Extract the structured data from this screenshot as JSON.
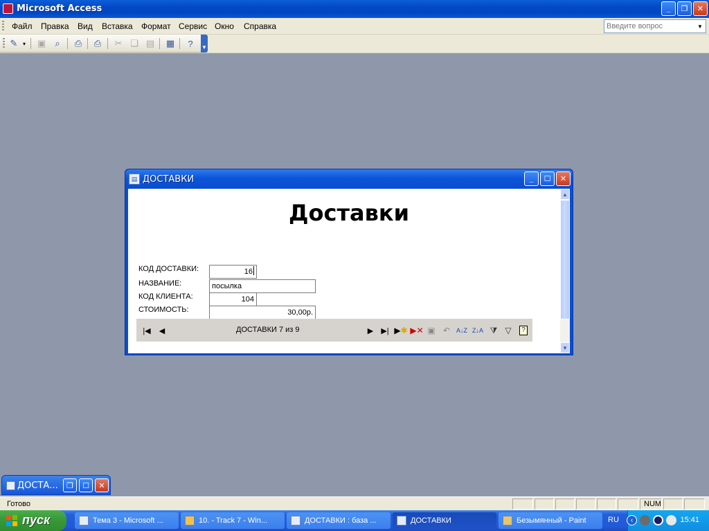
{
  "app": {
    "title": "Microsoft Access"
  },
  "menu": {
    "items": [
      "Файл",
      "Правка",
      "Вид",
      "Вставка",
      "Формат",
      "Сервис",
      "Окно",
      "Справка"
    ],
    "ask_placeholder": "Введите вопрос"
  },
  "toolbar": {
    "icons": [
      "design-view-icon",
      "save-icon",
      "search-icon",
      "print-preview-icon",
      "print-icon",
      "cut-icon",
      "copy-icon",
      "paste-icon",
      "database-window-icon",
      "help-icon"
    ]
  },
  "form": {
    "window_title": "ДОСТАВКИ",
    "heading": "Доставки",
    "fields": [
      {
        "label": "КОД ДОСТАВКИ:",
        "value": "16"
      },
      {
        "label": "НАЗВАНИЕ:",
        "value": "посылка"
      },
      {
        "label": "КОД КЛИЕНТА:",
        "value": "104"
      },
      {
        "label": "СТОИМОСТЬ:",
        "value": "30,00р."
      }
    ],
    "navigator_text": "ДОСТАВКИ 7 из 9"
  },
  "minimized": {
    "title": "ДОСТА..."
  },
  "status": {
    "text": "Готово",
    "num": "NUM"
  },
  "taskbar": {
    "start": "пуск",
    "tasks": [
      "Тема 3 - Microsoft ...",
      "10. - Track 7 - Win...",
      "ДОСТАВКИ : база ...",
      "ДОСТАВКИ",
      "Безымянный - Paint"
    ],
    "lang": "RU",
    "time": "15:41"
  }
}
